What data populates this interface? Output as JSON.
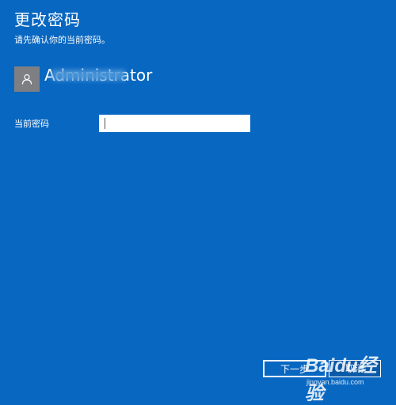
{
  "header": {
    "title": "更改密码",
    "subtitle": "请先确认你的当前密码。"
  },
  "account": {
    "username": "Administrator",
    "avatar_icon": "user-silhouette-icon"
  },
  "form": {
    "current_password_label": "当前密码",
    "current_password_value": ""
  },
  "footer": {
    "next_label": "下一步",
    "cancel_label": "取消"
  },
  "watermark": {
    "logo_text": "Baidu经验",
    "url": "jingyan.baidu.com"
  },
  "colors": {
    "background": "#0867c1",
    "avatar_bg": "#7d7f83",
    "text": "#ffffff"
  }
}
